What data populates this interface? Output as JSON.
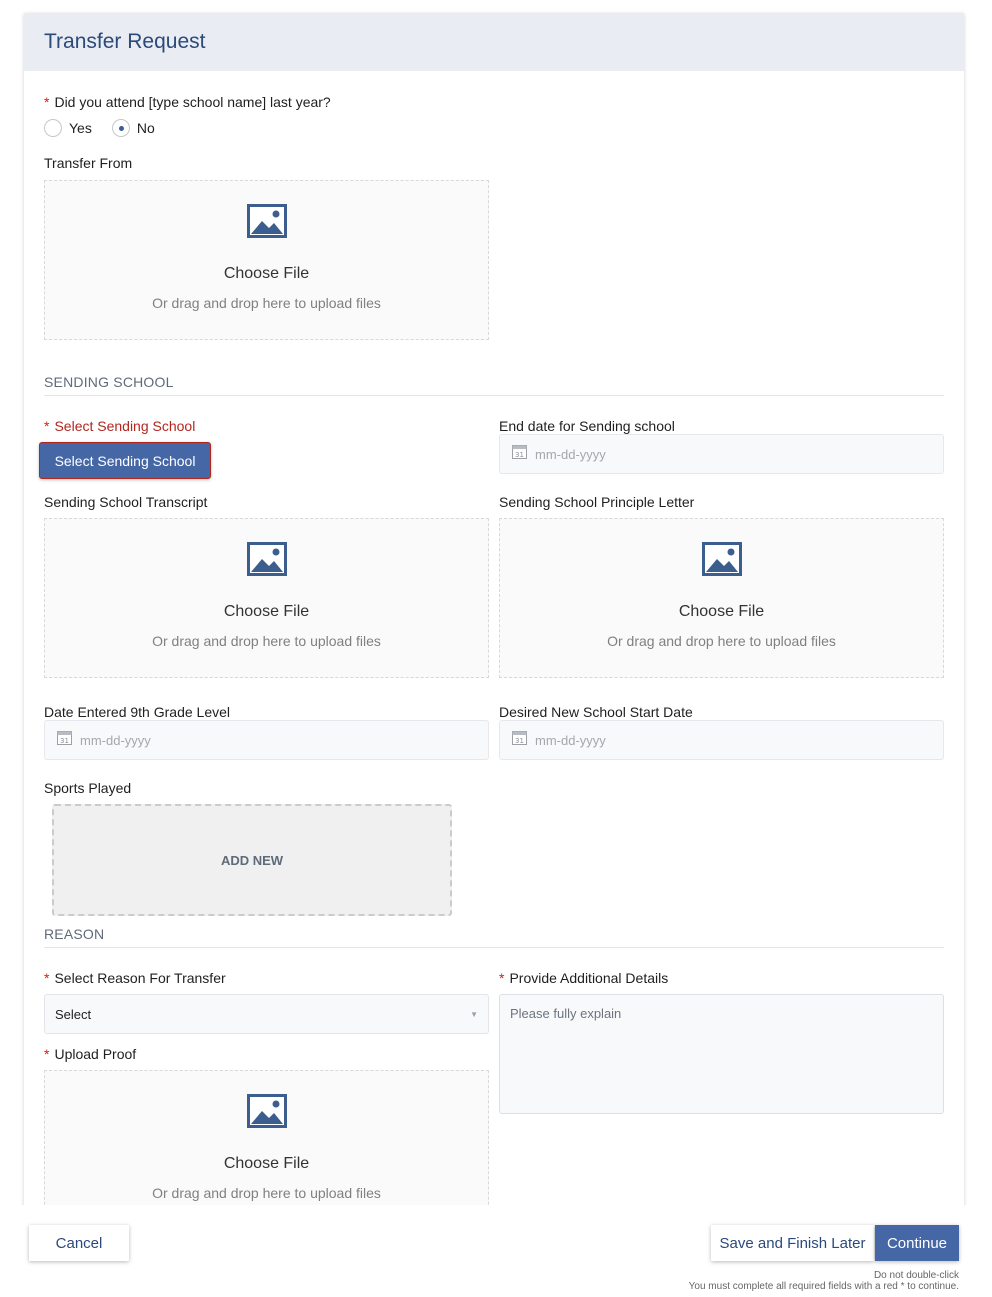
{
  "header": {
    "title": "Transfer Request"
  },
  "attend_question": {
    "label": "Did you attend [type school name] last year?",
    "options": [
      {
        "label": "Yes",
        "checked": false
      },
      {
        "label": "No",
        "checked": true
      }
    ]
  },
  "transfer_from": {
    "label": "Transfer From",
    "upload": {
      "choose": "Choose File",
      "hint": "Or drag and drop here to upload files"
    }
  },
  "sending_school": {
    "section_title": "SENDING SCHOOL",
    "select_label": "Select Sending School",
    "select_button": "Select Sending School",
    "end_date_label": "End date for Sending school",
    "end_date_placeholder": "mm-dd-yyyy",
    "transcript": {
      "label": "Sending School Transcript",
      "upload": {
        "choose": "Choose File",
        "hint": "Or drag and drop here to upload files"
      }
    },
    "principal_letter": {
      "label": "Sending School Principle Letter",
      "upload": {
        "choose": "Choose File",
        "hint": "Or drag and drop here to upload files"
      }
    },
    "ninth_grade": {
      "label": "Date Entered 9th Grade Level",
      "placeholder": "mm-dd-yyyy"
    },
    "desired_start": {
      "label": "Desired New School Start Date",
      "placeholder": "mm-dd-yyyy"
    },
    "sports": {
      "label": "Sports Played",
      "add_new": "ADD NEW"
    }
  },
  "reason": {
    "section_title": "REASON",
    "reason_label": "Select Reason For Transfer",
    "reason_value": "Select",
    "details_label": "Provide Additional Details",
    "details_placeholder": "Please fully explain",
    "proof": {
      "label": "Upload Proof",
      "upload": {
        "choose": "Choose File",
        "hint": "Or drag and drop here to upload files"
      }
    }
  },
  "footer": {
    "cancel": "Cancel",
    "save_later": "Save and Finish Later",
    "continue": "Continue",
    "note_1": "Do not double-click",
    "note_2": "You must complete all required fields with a red * to continue."
  },
  "colors": {
    "primary": "#4567a6",
    "title": "#2b4a7a",
    "required": "#c0281c",
    "header_bg": "#e9ecf3"
  }
}
